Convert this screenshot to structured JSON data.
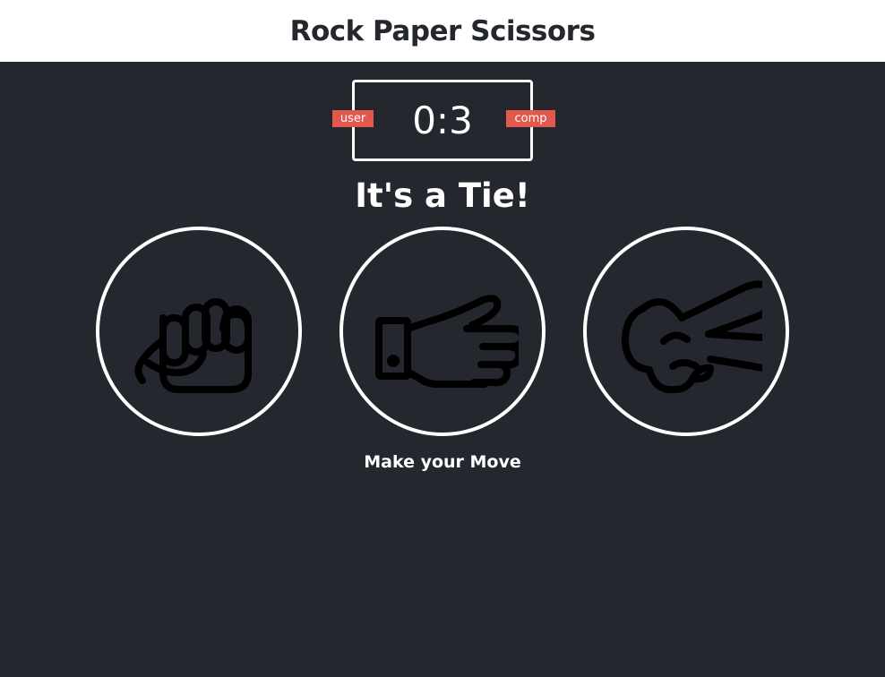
{
  "header": {
    "title": "Rock Paper Scissors"
  },
  "scoreboard": {
    "user_label": "user",
    "comp_label": "comp",
    "user_score": 0,
    "comp_score": 3,
    "display": "0:3",
    "badge_color": "#e2584d"
  },
  "result": {
    "message": "It's a Tie!"
  },
  "choices": [
    {
      "id": "rock",
      "icon": "fist-icon"
    },
    {
      "id": "paper",
      "icon": "open-hand-icon"
    },
    {
      "id": "scissors",
      "icon": "peace-sign-hand-icon"
    }
  ],
  "action_message": "Make your Move",
  "colors": {
    "background": "#24272e",
    "header_background": "#ffffff",
    "text": "#ffffff",
    "title_text": "#24272e"
  }
}
